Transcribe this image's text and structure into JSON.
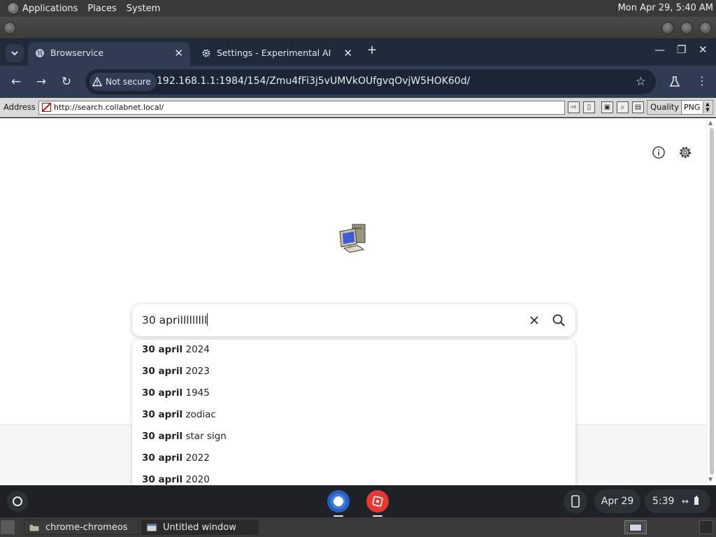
{
  "top_panel": {
    "menus": [
      "Applications",
      "Places",
      "System"
    ],
    "clock": "Mon Apr 29,  5:40 AM"
  },
  "browser": {
    "tabs": [
      {
        "title": "Browservice",
        "icon": "globe-icon",
        "active": true
      },
      {
        "title": "Settings - Experimental AI",
        "icon": "gear-icon",
        "active": false
      }
    ],
    "new_tab": "+",
    "omnibox": {
      "security_chip": "Not secure",
      "url": "192.168.1.1:1984/154/Zmu4fFi3j5vUMVkOUfgvqOvjW5HOK60d/"
    }
  },
  "addressbar": {
    "label": "Address",
    "url": "http://search.collabnet.local/",
    "quality_label": "Quality",
    "quality_value": "PNG"
  },
  "search": {
    "query": "30 aprilllllllll",
    "suggestions": [
      {
        "bold": "30 april",
        "rest": " 2024"
      },
      {
        "bold": "30 april",
        "rest": " 2023"
      },
      {
        "bold": "30 april",
        "rest": " 1945"
      },
      {
        "bold": "30 april",
        "rest": " zodiac"
      },
      {
        "bold": "30 april",
        "rest": " star sign"
      },
      {
        "bold": "30 april",
        "rest": " 2022"
      },
      {
        "bold": "30 april",
        "rest": " 2020"
      }
    ]
  },
  "shelf": {
    "date": "Apr 29",
    "time": "5:39"
  },
  "bottom_panel": {
    "tasks": [
      "chrome-chromeos",
      "Untitled window"
    ]
  }
}
